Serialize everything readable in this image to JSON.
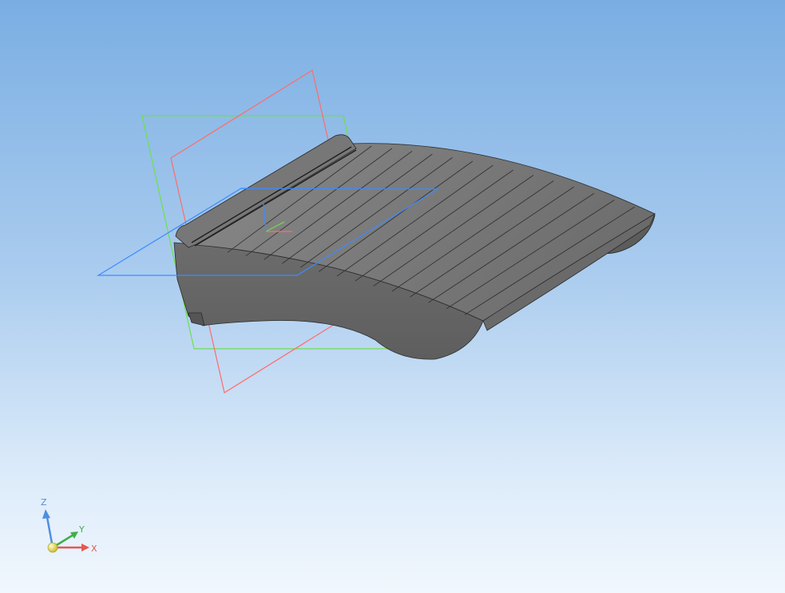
{
  "viewport": {
    "background_top": "#7aaee3",
    "background_bottom": "#f1f7fd"
  },
  "model": {
    "body_color": "#6f6f6f",
    "top_face_color": "#7b7b7b",
    "front_face_color": "#696969",
    "edge_color": "#2a2a2a"
  },
  "planes": [
    {
      "name": "XY",
      "color": "#3d8bff"
    },
    {
      "name": "ZX",
      "color": "#ff6b6b"
    },
    {
      "name": "ZY",
      "color": "#6de04a"
    }
  ],
  "triad": {
    "x_label": "X",
    "y_label": "Y",
    "z_label": "Z",
    "x_color": "#e8574f",
    "y_color": "#3fae49",
    "z_color": "#4f8fe0",
    "origin_color": "#f2e84a",
    "icons": [
      "x-axis-arrow-icon",
      "y-axis-arrow-icon",
      "z-axis-arrow-icon",
      "origin-sphere-icon"
    ]
  }
}
